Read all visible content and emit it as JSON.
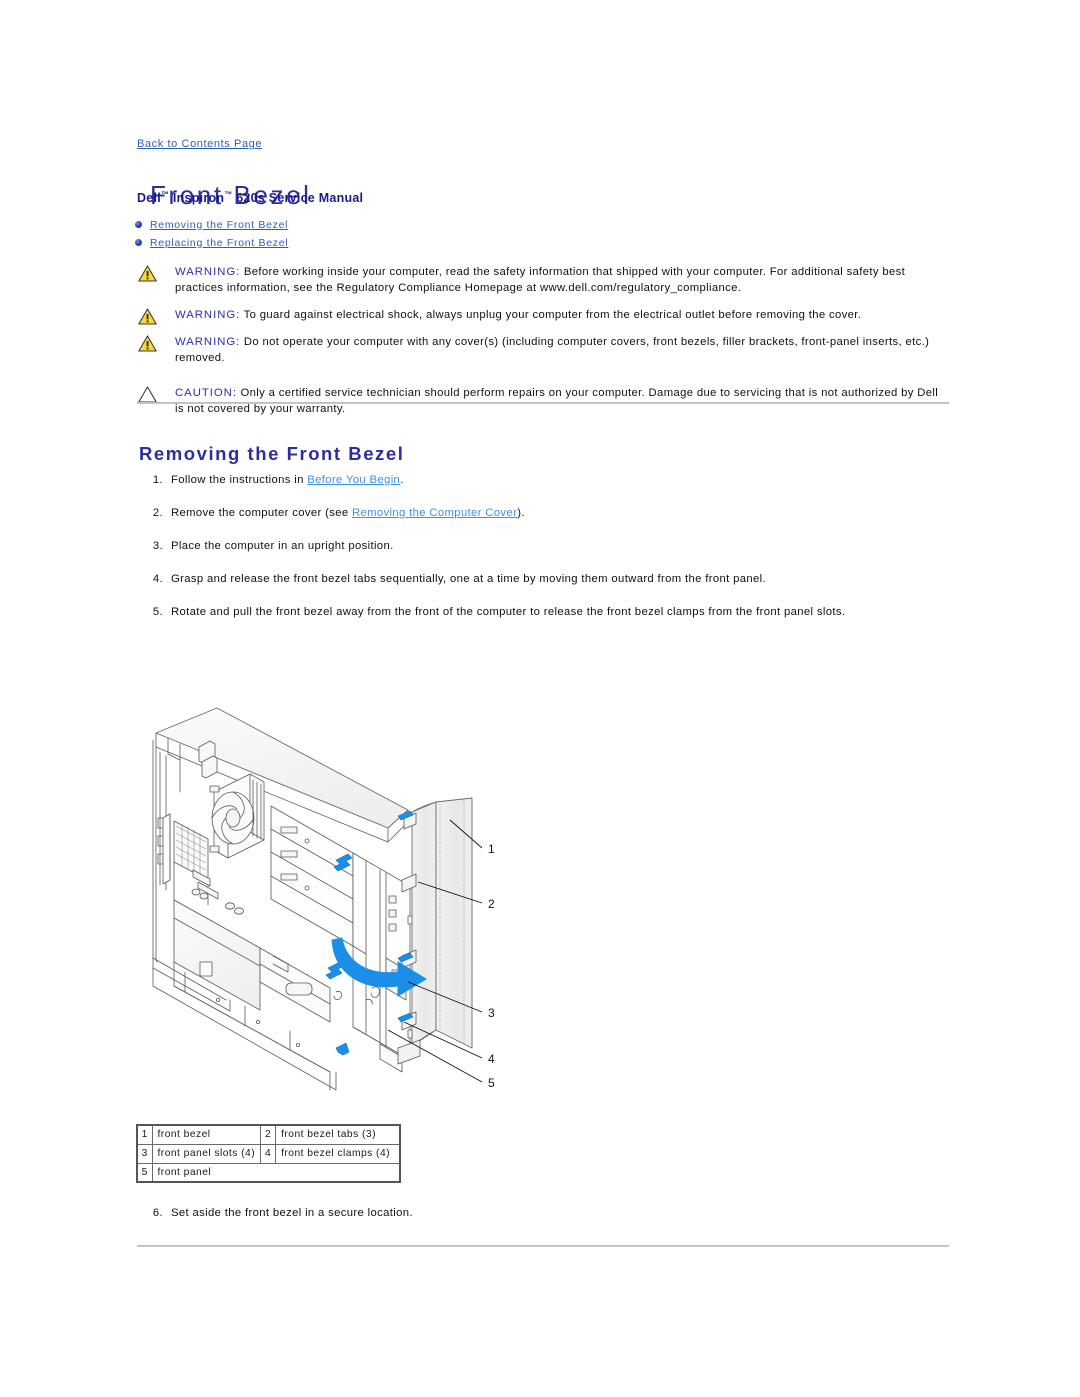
{
  "nav": {
    "back_link": "Back to Contents Page"
  },
  "header": {
    "title": "Front Bezel",
    "subtitle_brand": "Dell",
    "subtitle_product": "Inspiron",
    "subtitle_rest": "620s Service Manual",
    "subtitle_full": "Dell™ Inspiron™ 620s Service Manual"
  },
  "toc": {
    "items": [
      {
        "label": "Removing the Front Bezel"
      },
      {
        "label": "Replacing the Front Bezel"
      }
    ]
  },
  "admonitions": [
    {
      "type": "warning",
      "label": "WARNING:",
      "text": " Before working inside your computer, read the safety information that shipped with your computer. For additional safety best practices information, see the Regulatory Compliance Homepage at www.dell.com/regulatory_compliance."
    },
    {
      "type": "warning",
      "label": "WARNING:",
      "text": " To guard against electrical shock, always unplug your computer from the electrical outlet before removing the cover."
    },
    {
      "type": "warning",
      "label": "WARNING:",
      "text": " Do not operate your computer with any cover(s) (including computer covers, front bezels, filler brackets, front-panel inserts, etc.) removed."
    },
    {
      "type": "caution",
      "label": "CAUTION:",
      "text": " Only a certified service technician should perform repairs on your computer. Damage due to servicing that is not authorized by Dell is not covered by your warranty."
    }
  ],
  "section": {
    "heading": "Removing the Front Bezel"
  },
  "steps": [
    {
      "num": "1.",
      "pre": "Follow the instructions in ",
      "link": "Before You Begin",
      "post": "."
    },
    {
      "num": "2.",
      "pre": "Remove the computer cover (see ",
      "link": "Removing the Computer Cover",
      "post": ")."
    },
    {
      "num": "3.",
      "pre": "Place the computer in an upright position.",
      "link": "",
      "post": ""
    },
    {
      "num": "4.",
      "pre": "Grasp and release the front bezel tabs sequentially, one at a time by moving them outward from the front panel.",
      "link": "",
      "post": ""
    },
    {
      "num": "5.",
      "pre": "Rotate and pull the front bezel away from the front of the computer to release the front bezel clamps from the front panel slots.",
      "link": "",
      "post": ""
    }
  ],
  "figure": {
    "callouts": [
      "1",
      "2",
      "3",
      "4",
      "5"
    ],
    "description": "Exploded view of computer chassis with front bezel rotating away from front panel"
  },
  "legend": {
    "rows": [
      [
        {
          "num": "1",
          "label": "front bezel"
        },
        {
          "num": "2",
          "label": "front bezel tabs (3)"
        }
      ],
      [
        {
          "num": "3",
          "label": "front panel slots (4)"
        },
        {
          "num": "4",
          "label": "front bezel clamps (4)"
        }
      ],
      [
        {
          "num": "5",
          "label": "front panel"
        }
      ]
    ]
  },
  "final_step": {
    "num": "6.",
    "text": "Set aside the front bezel in a secure location."
  },
  "colors": {
    "title_blue": "#2b2f9e",
    "link_blue": "#2d5fb5",
    "inline_link_blue": "#3d8ef0",
    "warning_yellow": "#f5d230",
    "accent_blue": "#1b8fe8",
    "rule_gray": "#c9c9c9"
  }
}
